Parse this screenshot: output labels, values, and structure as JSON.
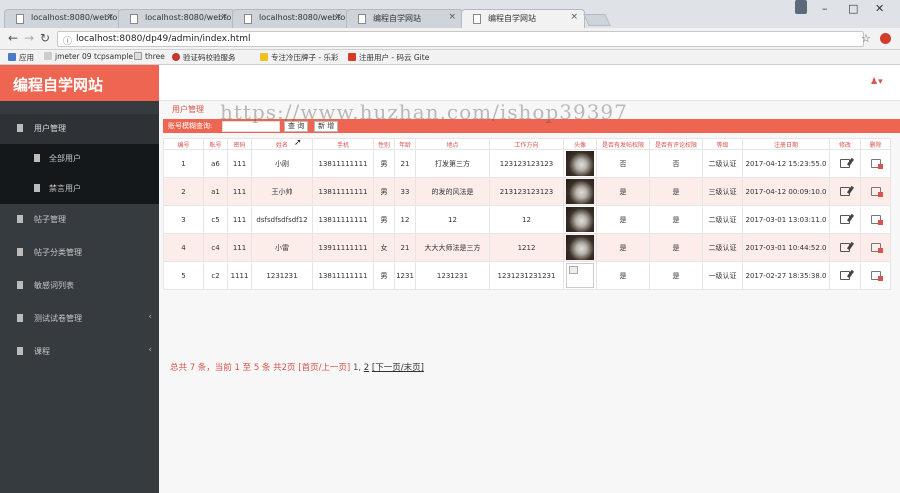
{
  "browser": {
    "tabs": [
      "localhost:8080/webto",
      "localhost:8080/webto",
      "localhost:8080/webto",
      "编程自学网站",
      "编程自学网站"
    ],
    "url": "localhost:8080/dp49/admin/index.html",
    "bookmarks": [
      "应用",
      "jmeter 09 tcpsample",
      "three",
      "验证码校验服务",
      "专注冷压牌子 - 乐彩",
      "注册用户 - 码云 Gite"
    ]
  },
  "app": {
    "title": "编程自学网站",
    "sidebar": [
      {
        "label": "用户管理",
        "arrow": ""
      },
      {
        "label": "全部用户"
      },
      {
        "label": "禁言用户"
      },
      {
        "label": "帖子管理",
        "arrow": ""
      },
      {
        "label": "帖子分类管理",
        "arrow": ""
      },
      {
        "label": "敏感词列表",
        "arrow": ""
      },
      {
        "label": "测试试卷管理",
        "arrow": "‹"
      },
      {
        "label": "课程",
        "arrow": "‹"
      }
    ],
    "breadcrumb": "用户管理",
    "search": {
      "label": "账号模糊查询:",
      "query_btn": "查 询",
      "add_btn": "新 增"
    },
    "table": {
      "headers": [
        "编号",
        "账号",
        "密码",
        "姓名",
        "手机",
        "性别",
        "年龄",
        "地点",
        "工作方向",
        "头像",
        "是否有发帖权限",
        "是否有评论权限",
        "等级",
        "注册日期",
        "修改",
        "删除"
      ],
      "rows": [
        [
          "1",
          "a6",
          "111",
          "小刚",
          "13811111111",
          "男",
          "21",
          "打发第三方",
          "123123123123",
          "",
          "否",
          "否",
          "二级认证",
          "2017-04-12 15:23:55.0"
        ],
        [
          "2",
          "a1",
          "111",
          "王小帅",
          "13811111111",
          "男",
          "33",
          "的发的风法是",
          "213123123123",
          "",
          "是",
          "是",
          "三级认证",
          "2017-04-12 00:09:10.0"
        ],
        [
          "3",
          "c5",
          "111",
          "dsfsdfsdfsdf12",
          "13811111111",
          "男",
          "12",
          "12",
          "12",
          "",
          "是",
          "是",
          "二级认证",
          "2017-03-01 13:03:11.0"
        ],
        [
          "4",
          "c4",
          "111",
          "小雷",
          "13911111111",
          "女",
          "21",
          "大大大师法是三方",
          "1212",
          "",
          "是",
          "是",
          "二级认证",
          "2017-03-01 10:44:52.0"
        ],
        [
          "5",
          "c2",
          "1111",
          "1231231",
          "13811111111",
          "男",
          "1231",
          "1231231",
          "1231231231231",
          "",
          "是",
          "是",
          "一级认证",
          "2017-02-27 18:35:38.0"
        ]
      ]
    },
    "pager": {
      "summary": "总共 7 条，当前 1 至 5 条 共2页",
      "first_prev": "[首页/上一页]",
      "page1": "1,",
      "page2": "2",
      "next_last": "[下一页/末页]"
    }
  },
  "watermark": "https://www.huzhan.com/ishop39397"
}
